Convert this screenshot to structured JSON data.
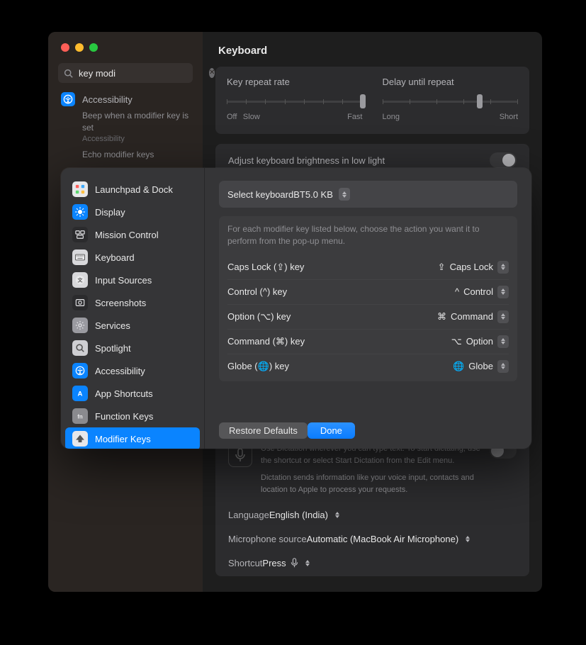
{
  "search": {
    "value": "key modi"
  },
  "title": "Keyboard",
  "sidebarResult": {
    "label": "Accessibility",
    "sub1": "Beep when a modifier key is set",
    "cat1": "Accessibility",
    "sub2": "Echo modifier keys"
  },
  "repeat": {
    "rateLabel": "Key repeat rate",
    "rateMin": "Off",
    "rateMin2": "Slow",
    "rateMax": "Fast",
    "delayLabel": "Delay until repeat",
    "delayMin": "Long",
    "delayMax": "Short"
  },
  "brightnessLabel": "Adjust keyboard brightness in low light",
  "sheet": {
    "items": [
      {
        "label": "Launchpad & Dock",
        "bg": "#e7e7ea"
      },
      {
        "label": "Display",
        "bg": "#0a84ff"
      },
      {
        "label": "Mission Control",
        "bg": "#2b2b2d"
      },
      {
        "label": "Keyboard",
        "bg": "#d8d8db"
      },
      {
        "label": "Input Sources",
        "bg": "#d8d8db"
      },
      {
        "label": "Screenshots",
        "bg": "#2b2b2d"
      },
      {
        "label": "Services",
        "bg": "#9a9aa0"
      },
      {
        "label": "Spotlight",
        "bg": "#cfcfd3"
      },
      {
        "label": "Accessibility",
        "bg": "#0a84ff"
      },
      {
        "label": "App Shortcuts",
        "bg": "#0a84ff"
      },
      {
        "label": "Function Keys",
        "bg": "#8a8a8e"
      },
      {
        "label": "Modifier Keys",
        "bg": "#e7e7ea"
      }
    ],
    "selectKeyboardLabel": "Select keyboard",
    "selectKeyboardValue": "BT5.0 KB",
    "desc": "For each modifier key listed below, choose the action you want it to perform from the pop-up menu.",
    "rows": [
      {
        "label": "Caps Lock (⇪) key",
        "sym": "⇪",
        "val": "Caps Lock"
      },
      {
        "label": "Control (^) key",
        "sym": "^",
        "val": "Control"
      },
      {
        "label": "Option (⌥) key",
        "sym": "⌘",
        "val": "Command"
      },
      {
        "label": "Command (⌘) key",
        "sym": "⌥",
        "val": "Option"
      },
      {
        "label": "Globe (🌐) key",
        "sym": "🌐",
        "val": "Globe"
      }
    ],
    "restore": "Restore Defaults",
    "done": "Done"
  },
  "dictation": {
    "line1": "Use Dictation wherever you can type text. To start dictating, use the shortcut or select Start Dictation from the Edit menu.",
    "line2": "Dictation sends information like your voice input, contacts and location to Apple to process your requests."
  },
  "langRow": {
    "label": "Language",
    "value": "English (India)"
  },
  "micRow": {
    "label": "Microphone source",
    "value": "Automatic (MacBook Air Microphone)"
  },
  "shortcutRow": {
    "label": "Shortcut",
    "value": "Press"
  }
}
